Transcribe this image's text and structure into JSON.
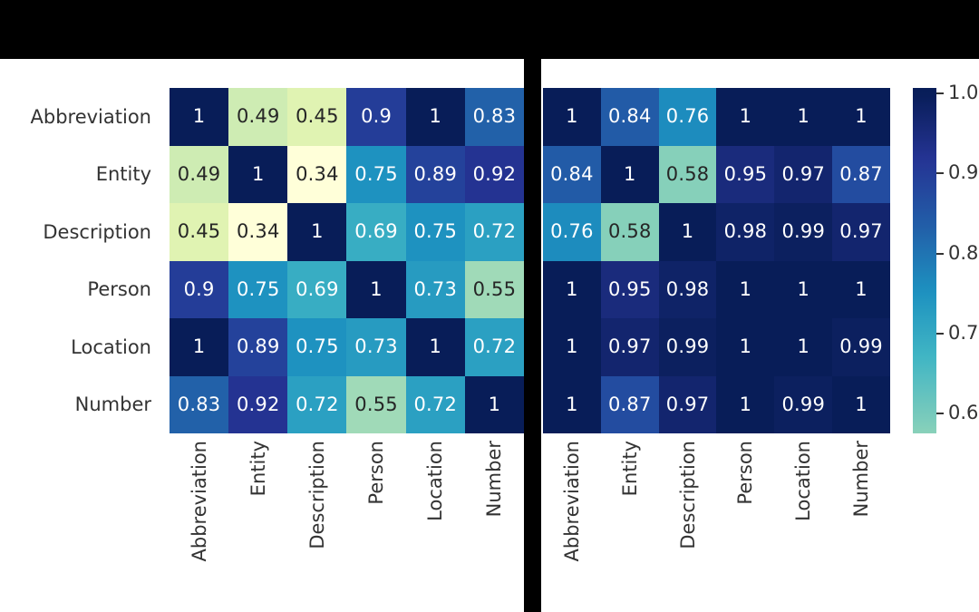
{
  "figure": {
    "background": "#ffffff",
    "band_color": "#000000",
    "tick_text_color": "#333333"
  },
  "chart_data": [
    {
      "type": "heatmap",
      "name": "left-heatmap",
      "title": "",
      "xlabel": "",
      "ylabel": "",
      "categories": [
        "Abbreviation",
        "Entity",
        "Description",
        "Person",
        "Location",
        "Number"
      ],
      "x_tick_labels": [
        "Abbreviation",
        "Entity",
        "Description",
        "Person",
        "Location",
        "Number"
      ],
      "y_tick_labels": [
        "Abbreviation",
        "Entity",
        "Description",
        "Person",
        "Location",
        "Number"
      ],
      "annot": true,
      "rows": [
        {
          "label": "Abbreviation",
          "values": [
            1,
            0.49,
            0.45,
            0.9,
            1,
            0.83
          ],
          "text": [
            "1",
            "0.49",
            "0.45",
            "0.9",
            "1",
            "0.83"
          ]
        },
        {
          "label": "Entity",
          "values": [
            0.49,
            1,
            0.34,
            0.75,
            0.89,
            0.92
          ],
          "text": [
            "0.49",
            "1",
            "0.34",
            "0.75",
            "0.89",
            "0.92"
          ]
        },
        {
          "label": "Description",
          "values": [
            0.45,
            0.34,
            1,
            0.69,
            0.75,
            0.72
          ],
          "text": [
            "0.45",
            "0.34",
            "1",
            "0.69",
            "0.75",
            "0.72"
          ]
        },
        {
          "label": "Person",
          "values": [
            0.9,
            0.75,
            0.69,
            1,
            0.73,
            0.55
          ],
          "text": [
            "0.9",
            "0.75",
            "0.69",
            "1",
            "0.73",
            "0.55"
          ]
        },
        {
          "label": "Location",
          "values": [
            1,
            0.89,
            0.75,
            0.73,
            1,
            0.72
          ],
          "text": [
            "1",
            "0.89",
            "0.75",
            "0.73",
            "1",
            "0.72"
          ]
        },
        {
          "label": "Number",
          "values": [
            0.83,
            0.92,
            0.72,
            0.55,
            0.72,
            1
          ],
          "text": [
            "0.83",
            "0.92",
            "0.72",
            "0.55",
            "0.72",
            "1"
          ]
        }
      ]
    },
    {
      "type": "heatmap",
      "name": "right-heatmap",
      "title": "",
      "xlabel": "",
      "ylabel": "",
      "categories": [
        "Abbreviation",
        "Entity",
        "Description",
        "Person",
        "Location",
        "Number"
      ],
      "x_tick_labels": [
        "Abbreviation",
        "Entity",
        "Description",
        "Person",
        "Location",
        "Number"
      ],
      "y_tick_labels": [],
      "annot": true,
      "rows": [
        {
          "label": "Abbreviation",
          "values": [
            1,
            0.84,
            0.76,
            1,
            1,
            1
          ],
          "text": [
            "1",
            "0.84",
            "0.76",
            "1",
            "1",
            "1"
          ]
        },
        {
          "label": "Entity",
          "values": [
            0.84,
            1,
            0.58,
            0.95,
            0.97,
            0.87
          ],
          "text": [
            "0.84",
            "1",
            "0.58",
            "0.95",
            "0.97",
            "0.87"
          ]
        },
        {
          "label": "Description",
          "values": [
            0.76,
            0.58,
            1,
            0.98,
            0.99,
            0.97
          ],
          "text": [
            "0.76",
            "0.58",
            "1",
            "0.98",
            "0.99",
            "0.97"
          ]
        },
        {
          "label": "Person",
          "values": [
            1,
            0.95,
            0.98,
            1,
            1,
            1
          ],
          "text": [
            "1",
            "0.95",
            "0.98",
            "1",
            "1",
            "1"
          ]
        },
        {
          "label": "Location",
          "values": [
            1,
            0.97,
            0.99,
            1,
            1,
            0.99
          ],
          "text": [
            "1",
            "0.97",
            "0.99",
            "1",
            "1",
            "0.99"
          ]
        },
        {
          "label": "Number",
          "values": [
            1,
            0.87,
            0.97,
            1,
            0.99,
            1
          ],
          "text": [
            "1",
            "0.87",
            "0.97",
            "1",
            "0.99",
            "1"
          ]
        }
      ]
    }
  ],
  "colorbar": {
    "name": "colorbar",
    "colormap": "YlGnBu",
    "vmin": 0.34,
    "vmax": 1.0,
    "display_min": 0.575,
    "display_max": 1.007,
    "ticks": [
      1.0,
      0.9,
      0.8,
      0.7,
      0.6
    ],
    "tick_labels": [
      "1.0",
      "0.9",
      "0.8",
      "0.7",
      "0.6"
    ],
    "stops": [
      "#ffffd9",
      "#edf8b1",
      "#c7e9b4",
      "#7fcdbb",
      "#41b6c4",
      "#1d91c0",
      "#225ea8",
      "#253494",
      "#081d58"
    ]
  }
}
